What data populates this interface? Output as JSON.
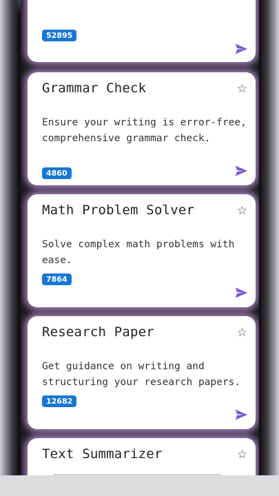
{
  "cards": [
    {
      "title": "",
      "description": "",
      "count": "52895"
    },
    {
      "title": "Grammar Check",
      "description": "Ensure your writing is error-free, comprehensive grammar check.",
      "count": "4860"
    },
    {
      "title": "Math Problem Solver",
      "description": "Solve complex math problems with ease.",
      "count": "7864"
    },
    {
      "title": "Research Paper",
      "description": "Get guidance on writing and structuring your research papers.",
      "count": "12682"
    },
    {
      "title": "Text Summarizer",
      "description": "",
      "count": ""
    }
  ],
  "icons": {
    "favorite": "star-outline-icon",
    "send": "paper-plane-icon",
    "star_glyph": "☆"
  },
  "colors": {
    "badge": "#1877d6",
    "send_icon": "#7b57d8",
    "card_glow": "#c396e1"
  }
}
